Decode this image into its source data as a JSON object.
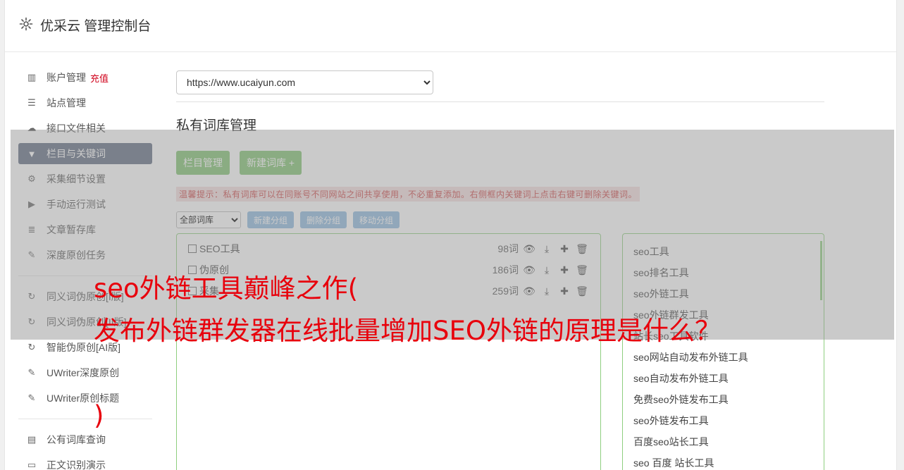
{
  "header": {
    "title": "优采云 管理控制台"
  },
  "sidebar": {
    "items": [
      {
        "label": "账户管理",
        "badge": "充值",
        "icon": "bar-chart-icon"
      },
      {
        "label": "站点管理",
        "icon": "server-icon"
      },
      {
        "label": "接口文件相关",
        "icon": "cloud-upload-icon"
      },
      {
        "label": "栏目与关键词",
        "icon": "filter-icon",
        "active": true
      },
      {
        "label": "采集细节设置",
        "icon": "gears-icon"
      },
      {
        "label": "手动运行测试",
        "icon": "play-circle-icon"
      },
      {
        "label": "文章暂存库",
        "icon": "database-icon"
      },
      {
        "label": "深度原创任务",
        "icon": "edit-icon"
      }
    ],
    "items2": [
      {
        "label": "同义词伪原创[I版]",
        "icon": "refresh-icon"
      },
      {
        "label": "同义词伪原创[II版]",
        "icon": "refresh-icon"
      },
      {
        "label": "智能伪原创[AI版]",
        "icon": "refresh-icon"
      },
      {
        "label": "UWriter深度原创",
        "icon": "edit-icon"
      },
      {
        "label": "UWriter原创标题",
        "icon": "edit-icon"
      }
    ],
    "items3": [
      {
        "label": "公有词库查询",
        "icon": "book-icon"
      },
      {
        "label": "正文识别演示",
        "icon": "monitor-icon"
      }
    ]
  },
  "main": {
    "site_select": "https://www.ucaiyun.com",
    "section_title": "私有词库管理",
    "btn_column": "栏目管理",
    "btn_new_lib": "新建词库 +",
    "tip": "温馨提示：私有词库可以在同账号不同网站之间共享使用，不必重复添加。右侧框内关键词上点击右键可删除关键词。",
    "group_select": "全部词库",
    "btn_new_group": "新建分组",
    "btn_del_group": "删除分组",
    "btn_move_group": "移动分组",
    "libraries": [
      {
        "name": "SEO工具",
        "count": "98词"
      },
      {
        "name": "伪原创",
        "count": "186词"
      },
      {
        "name": "采集",
        "count": "259词"
      }
    ],
    "keywords": [
      "seo工具",
      "seo排名工具",
      "seo外链工具",
      "seo外链群发工具",
      "站长seo工具软件",
      "seo网站自动发布外链工具",
      "seo自动发布外链工具",
      "免费seo外链发布工具",
      "seo外链发布工具",
      "百度seo站长工具",
      "seo 百度 站长工具"
    ]
  },
  "overlay": {
    "line1": "seo外链工具巅峰之作(",
    "line2": "发布外链群发器在线批量增加SEO外链的原理是什么？",
    "line3": ")"
  },
  "colors": {
    "accent_green": "#7fc26e",
    "accent_blue": "#8db8df",
    "active_nav": "#5f6b80",
    "caption_red": "#e8000c"
  }
}
